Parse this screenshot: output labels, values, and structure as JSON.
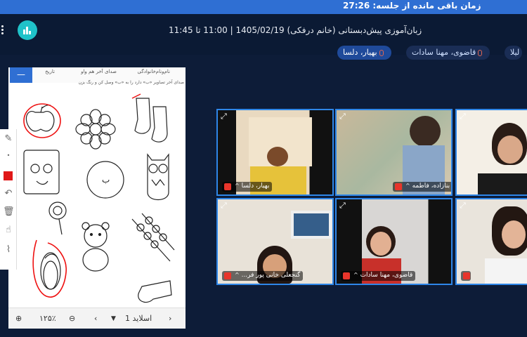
{
  "top_banner": {
    "text": "زمان باقی مانده از جلسه: 27:26"
  },
  "header": {
    "title": "زبان‌آموزی پیش‌دبستانی (خانم درفکی) 1405/02/19 | 11:00 تا 11:45"
  },
  "participants_bar": [
    {
      "label": "بهیار، دلسا",
      "style": "blue"
    },
    {
      "label": "قاضوی، مهنا سادات",
      "style": "dark"
    },
    {
      "label": "لیلا",
      "style": "dark"
    }
  ],
  "whiteboard": {
    "header_right": "نام‌ونام‌خانوادگی",
    "header_mid": "صدای آخر هم واو",
    "header_left": "تاریخ",
    "instructions": "صدای آخر تصاویر «ب» دارد را به «ب» وصل کن و رنگ بزن",
    "center_letter": "ب",
    "footer": {
      "zoom": "۱۲۵٪",
      "slide_label": "اسلاید 1"
    }
  },
  "video_tiles": [
    {
      "name": "بهیار، دلسا",
      "colors": [
        "#e9d9c0",
        "#f2e4cc",
        "#d8b07a"
      ]
    },
    {
      "name": "بنازاده، فاطمه",
      "colors": [
        "#a9b8a0",
        "#d9c9b0",
        "#6d8aa8"
      ]
    },
    {
      "name": "",
      "colors": [
        "#f4efe6",
        "#c9b59a",
        "#8a6a4a"
      ]
    },
    {
      "name": "گنجعلی خانی پور فر...",
      "colors": [
        "#e8e2d8",
        "#b8c8d8",
        "#7a5a40"
      ]
    },
    {
      "name": "قاضوی، مهنا سادات",
      "colors": [
        "#d8d6d4",
        "#e6e4e0",
        "#c0302a"
      ]
    },
    {
      "name": "",
      "colors": [
        "#e9e4dc",
        "#d8d0c6",
        "#3a2a20"
      ]
    }
  ],
  "colors": {
    "accent": "#2f6fd3",
    "tile_border": "#2e86e8",
    "background": "#0d1c38",
    "mute_red": "#e8352b"
  }
}
